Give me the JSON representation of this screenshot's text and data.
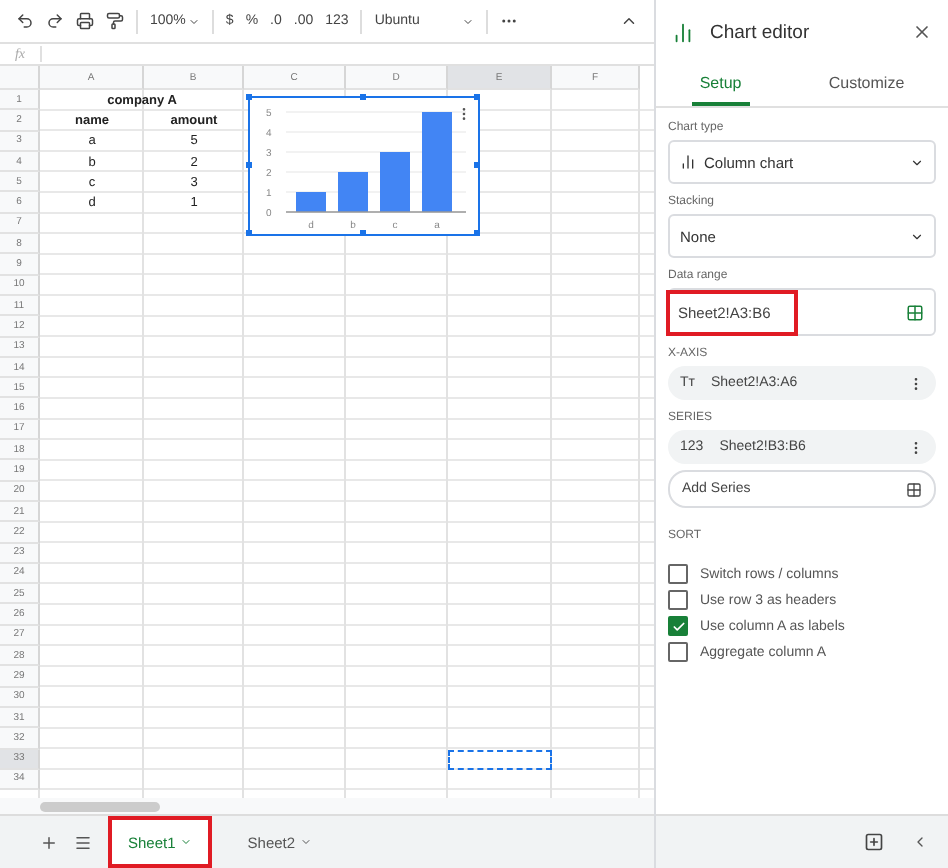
{
  "toolbar": {
    "zoom": "100%",
    "format_buttons": [
      "$",
      "%",
      ".0",
      ".00",
      "123"
    ],
    "font": "Ubuntu"
  },
  "formula_bar": {
    "label": "fx"
  },
  "columns": [
    {
      "label": "A",
      "selected": false
    },
    {
      "label": "B",
      "selected": false
    },
    {
      "label": "C",
      "selected": false
    },
    {
      "label": "D",
      "selected": false
    },
    {
      "label": "E",
      "selected": true
    },
    {
      "label": "F",
      "selected": false
    }
  ],
  "rows": [
    {
      "number": "1",
      "selected": false,
      "cells": [
        {
          "text": "company A",
          "merged": true,
          "bold": true
        }
      ]
    },
    {
      "number": "2",
      "selected": false,
      "cells": [
        {
          "text": "name",
          "merged": false,
          "bold": true
        },
        {
          "text": "amount",
          "merged": false,
          "bold": true
        }
      ]
    },
    {
      "number": "3",
      "selected": false,
      "cells": [
        {
          "text": "a",
          "merged": false,
          "bold": false
        },
        {
          "text": "5",
          "merged": false,
          "bold": false
        }
      ]
    },
    {
      "number": "4",
      "selected": false,
      "cells": [
        {
          "text": "b",
          "merged": false,
          "bold": false
        },
        {
          "text": "2",
          "merged": false,
          "bold": false
        }
      ]
    },
    {
      "number": "5",
      "selected": false,
      "cells": [
        {
          "text": "c",
          "merged": false,
          "bold": false
        },
        {
          "text": "3",
          "merged": false,
          "bold": false
        }
      ]
    },
    {
      "number": "6",
      "selected": false,
      "cells": [
        {
          "text": "d",
          "merged": false,
          "bold": false
        },
        {
          "text": "1",
          "merged": false,
          "bold": false
        }
      ]
    },
    {
      "number": "7",
      "selected": false
    },
    {
      "number": "8",
      "selected": false
    },
    {
      "number": "9",
      "selected": false
    },
    {
      "number": "10",
      "selected": false
    },
    {
      "number": "11",
      "selected": false
    },
    {
      "number": "12",
      "selected": false
    },
    {
      "number": "13",
      "selected": false
    },
    {
      "number": "14",
      "selected": false
    },
    {
      "number": "15",
      "selected": false
    },
    {
      "number": "16",
      "selected": false
    },
    {
      "number": "17",
      "selected": false
    },
    {
      "number": "18",
      "selected": false
    },
    {
      "number": "19",
      "selected": false
    },
    {
      "number": "20",
      "selected": false
    },
    {
      "number": "21",
      "selected": false
    },
    {
      "number": "22",
      "selected": false
    },
    {
      "number": "23",
      "selected": false
    },
    {
      "number": "24",
      "selected": false
    },
    {
      "number": "25",
      "selected": false
    },
    {
      "number": "26",
      "selected": false
    },
    {
      "number": "27",
      "selected": false
    },
    {
      "number": "28",
      "selected": false
    },
    {
      "number": "29",
      "selected": false
    },
    {
      "number": "30",
      "selected": false
    },
    {
      "number": "31",
      "selected": false
    },
    {
      "number": "32",
      "selected": false
    },
    {
      "number": "33",
      "selected": true
    },
    {
      "number": "34",
      "selected": false
    }
  ],
  "chart": {
    "chart_data": {
      "type": "bar",
      "categories": [
        "d",
        "b",
        "c",
        "a"
      ],
      "values": [
        1,
        2,
        3,
        5
      ],
      "ylim": [
        0,
        5
      ],
      "yticks": [
        0,
        1,
        2,
        3,
        4,
        5
      ],
      "grid": true
    }
  },
  "sheet_tabs": [
    {
      "label": "Sheet1",
      "selected": true,
      "highlighted": true
    },
    {
      "label": "Sheet2",
      "selected": false,
      "highlighted": false
    }
  ],
  "editor": {
    "title": "Chart editor",
    "tabs": [
      {
        "label": "Setup",
        "selected": true
      },
      {
        "label": "Customize",
        "selected": false
      }
    ],
    "chart_type": {
      "label": "Chart type",
      "value": "Column chart"
    },
    "stacking": {
      "label": "Stacking",
      "value": "None"
    },
    "data_range": {
      "label": "Data range",
      "value": "Sheet2!A3:B6",
      "highlighted": true
    },
    "x_axis": {
      "label": "X-AXIS",
      "badge": "Tт",
      "value": "Sheet2!A3:A6"
    },
    "series": {
      "label": "SERIES",
      "badge": "123",
      "value": "Sheet2!B3:B6",
      "add": "Add Series"
    },
    "sort": {
      "label": "SORT"
    },
    "options": [
      {
        "label": "Switch rows / columns",
        "checked": false
      },
      {
        "label": "Use row 3 as headers",
        "checked": false
      },
      {
        "label": "Use column A as labels",
        "checked": true
      },
      {
        "label": "Aggregate column A",
        "checked": false
      }
    ]
  }
}
